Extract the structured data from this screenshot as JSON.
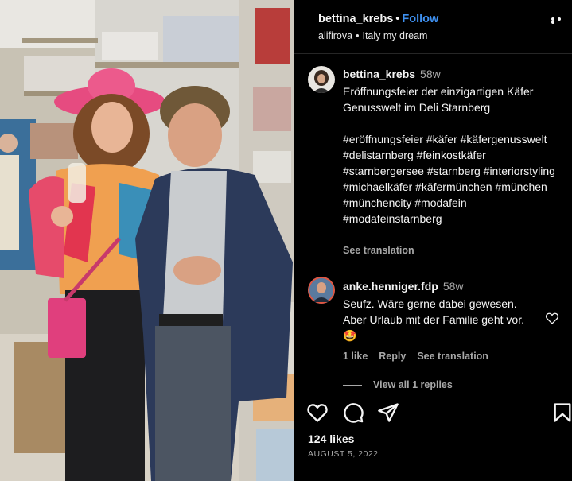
{
  "post": {
    "username": "bettina_krebs",
    "follow_label": "Follow",
    "tagged_user": "alifirova",
    "location": "Italy my dream"
  },
  "caption": {
    "username": "bettina_krebs",
    "time_ago": "58w",
    "text": "Eröffnungsfeier der einzigartigen Käfer Genusswelt im Deli Starnberg",
    "hashtags": "#eröffnungsfeier #käfer #käfergenusswelt #delistarnberg #feinkostkäfer #starnbergersee #starnberg #interiorstyling #michaelkäfer #käfermünchen #münchen #münchencity #modafein #modafeinstarnberg",
    "see_translation": "See translation"
  },
  "comment": {
    "username": "anke.henniger.fdp",
    "time_ago": "58w",
    "text": "Seufz. Wäre gerne dabei gewesen. Aber Urlaub mit der Familie geht vor. 🤩",
    "likes_label": "1 like",
    "reply_label": "Reply",
    "see_translation": "See translation",
    "view_replies": "View all 1 replies"
  },
  "footer": {
    "likes": "124 likes",
    "date": "AUGUST 5, 2022"
  },
  "icons": {
    "like": "heart-icon",
    "comment": "comment-icon",
    "share": "send-icon",
    "save": "bookmark-icon",
    "more": "more-options-icon"
  },
  "colors": {
    "background": "#000000",
    "follow": "#3e90f0",
    "secondary_text": "#a8a8a8",
    "divider": "#262626"
  }
}
